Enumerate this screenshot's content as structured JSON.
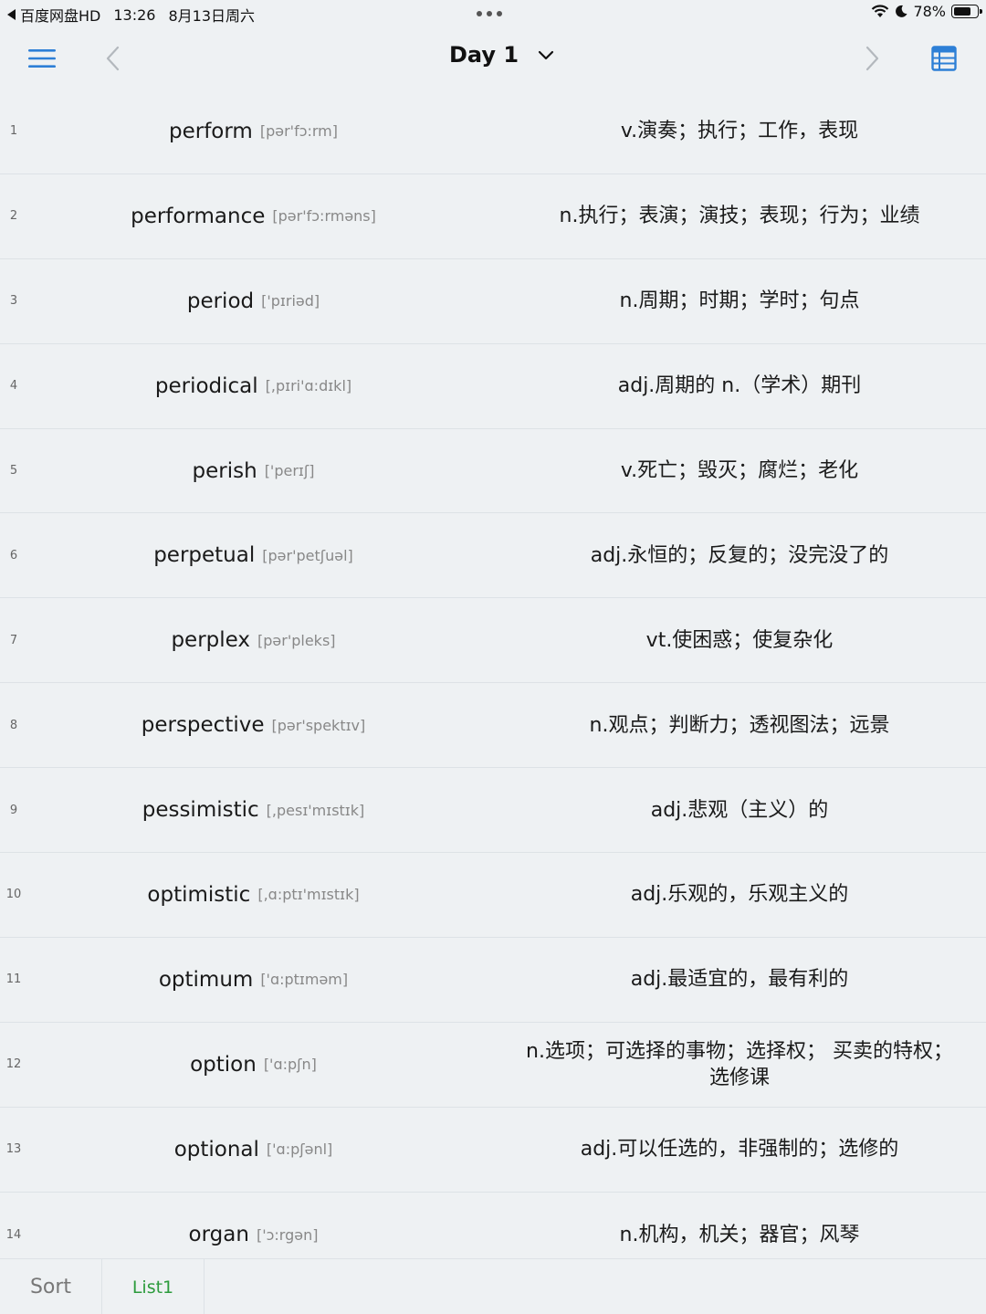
{
  "status_bar": {
    "back_app": "百度网盘HD",
    "time": "13:26",
    "date": "8月13日周六",
    "battery": "78%",
    "battery_level": 0.78
  },
  "nav": {
    "title": "Day 1",
    "icons": [
      "menu-icon",
      "chevron-left-icon",
      "chevron-down-icon",
      "chevron-right-icon",
      "list-view-icon"
    ],
    "accent": "#2d7fd6"
  },
  "words": [
    {
      "n": "1",
      "word": "perform",
      "phon": "[pər'fɔ:rm]",
      "def": "v.演奏；执行；工作，表现"
    },
    {
      "n": "2",
      "word": "performance",
      "phon": "[pər'fɔ:rməns]",
      "def": "n.执行；表演；演技；表现；行为；业绩"
    },
    {
      "n": "3",
      "word": "period",
      "phon": "['pɪriəd]",
      "def": "n.周期；时期；学时；句点"
    },
    {
      "n": "4",
      "word": "periodical",
      "phon": "[,pɪri'ɑ:dɪkl]",
      "def": "adj.周期的 n.（学术）期刊"
    },
    {
      "n": "5",
      "word": "perish",
      "phon": "['perɪʃ]",
      "def": "v.死亡；毁灭；腐烂；老化"
    },
    {
      "n": "6",
      "word": "perpetual",
      "phon": "[pər'petʃuəl]",
      "def": "adj.永恒的；反复的；没完没了的"
    },
    {
      "n": "7",
      "word": "perplex",
      "phon": "[pər'pleks]",
      "def": "vt.使困惑；使复杂化"
    },
    {
      "n": "8",
      "word": "perspective",
      "phon": "[pər'spektɪv]",
      "def": "n.观点；判断力；透视图法；远景"
    },
    {
      "n": "9",
      "word": "pessimistic",
      "phon": "[,pesɪ'mɪstɪk]",
      "def": "adj.悲观（主义）的"
    },
    {
      "n": "10",
      "word": "optimistic",
      "phon": "[,ɑ:ptɪ'mɪstɪk]",
      "def": "adj.乐观的，乐观主义的"
    },
    {
      "n": "11",
      "word": "optimum",
      "phon": "['ɑ:ptɪməm]",
      "def": "adj.最适宜的，最有利的"
    },
    {
      "n": "12",
      "word": "option",
      "phon": "['ɑ:pʃn]",
      "def": "n.选项；可选择的事物；选择权； 买卖的特权；选修课"
    },
    {
      "n": "13",
      "word": "optional",
      "phon": "['ɑ:pʃənl]",
      "def": "adj.可以任选的，非强制的；选修的"
    },
    {
      "n": "14",
      "word": "organ",
      "phon": "['ɔ:rgən]",
      "def": "n.机构，机关；器官；风琴"
    }
  ],
  "tabs": {
    "sort": "Sort",
    "list1": "List1",
    "active_color": "#2c9b3c"
  }
}
